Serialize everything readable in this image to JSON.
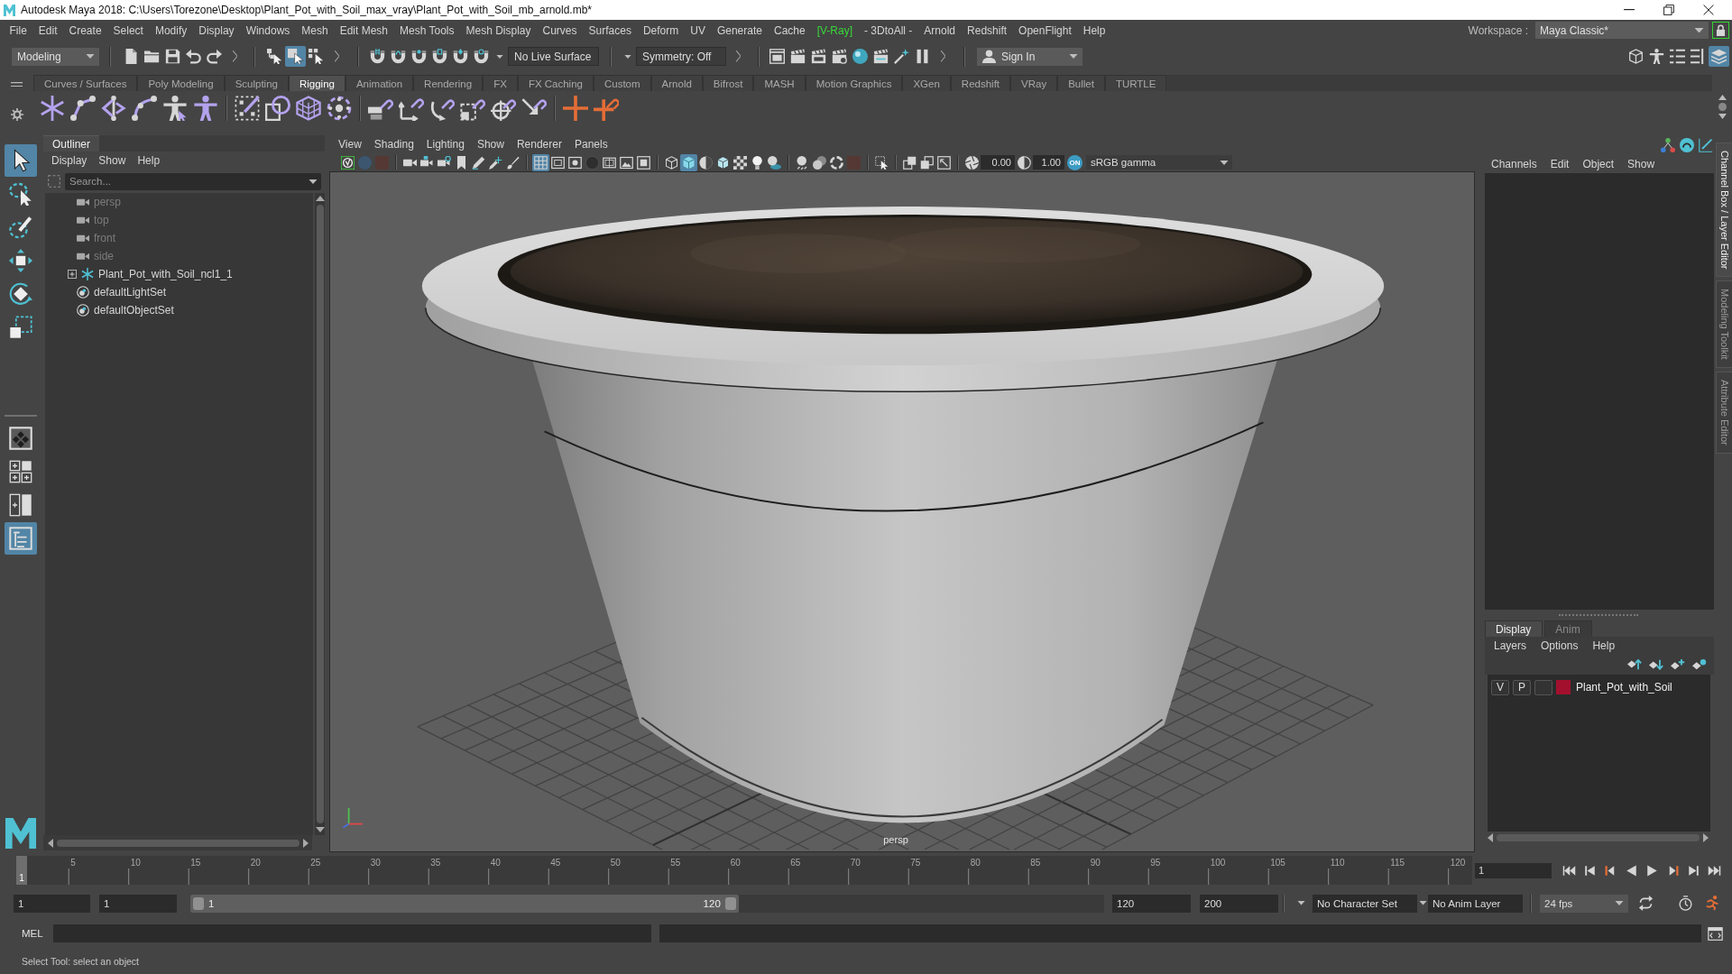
{
  "window": {
    "title": "Autodesk Maya 2018: C:\\Users\\Torezone\\Desktop\\Plant_Pot_with_Soil_max_vray\\Plant_Pot_with_Soil_mb_arnold.mb*"
  },
  "menu_bar": {
    "items": [
      {
        "label": "File",
        "highlighted": false
      },
      {
        "label": "Edit",
        "highlighted": false
      },
      {
        "label": "Create",
        "highlighted": false
      },
      {
        "label": "Select",
        "highlighted": false
      },
      {
        "label": "Modify",
        "highlighted": false
      },
      {
        "label": "Display",
        "highlighted": false
      },
      {
        "label": "Windows",
        "highlighted": false
      },
      {
        "label": "Mesh",
        "highlighted": false
      },
      {
        "label": "Edit Mesh",
        "highlighted": false
      },
      {
        "label": "Mesh Tools",
        "highlighted": false
      },
      {
        "label": "Mesh Display",
        "highlighted": false
      },
      {
        "label": "Curves",
        "highlighted": false
      },
      {
        "label": "Surfaces",
        "highlighted": false
      },
      {
        "label": "Deform",
        "highlighted": false
      },
      {
        "label": "UV",
        "highlighted": false
      },
      {
        "label": "Generate",
        "highlighted": false
      },
      {
        "label": "Cache",
        "highlighted": false
      },
      {
        "label": "[V-Ray]",
        "highlighted": true
      },
      {
        "label": "- 3DtoAll -",
        "highlighted": false
      },
      {
        "label": "Arnold",
        "highlighted": false
      },
      {
        "label": "Redshift",
        "highlighted": false
      },
      {
        "label": "OpenFlight",
        "highlighted": false
      },
      {
        "label": "Help",
        "highlighted": false
      }
    ],
    "workspace_label": "Workspace :",
    "workspace": "Maya Classic*"
  },
  "status_line": {
    "menu_set": "Modeling",
    "select_modes": [
      {
        "selected": false
      },
      {
        "selected": true
      },
      {
        "selected": false
      }
    ],
    "live_surface": "No Live Surface",
    "symmetry": "Symmetry: Off",
    "sign_in": "Sign In",
    "panel_toggles": [
      {
        "on": false
      },
      {
        "on": false
      },
      {
        "on": false
      },
      {
        "on": false
      },
      {
        "on": true
      }
    ]
  },
  "shelf": {
    "tabs": [
      {
        "label": "Curves / Surfaces",
        "selected": false
      },
      {
        "label": "Poly Modeling",
        "selected": false
      },
      {
        "label": "Sculpting",
        "selected": false
      },
      {
        "label": "Rigging",
        "selected": true
      },
      {
        "label": "Animation",
        "selected": false
      },
      {
        "label": "Rendering",
        "selected": false
      },
      {
        "label": "FX",
        "selected": false
      },
      {
        "label": "FX Caching",
        "selected": false
      },
      {
        "label": "Custom",
        "selected": false
      },
      {
        "label": "Arnold",
        "selected": false
      },
      {
        "label": "Bifrost",
        "selected": false
      },
      {
        "label": "MASH",
        "selected": false
      },
      {
        "label": "Motion Graphics",
        "selected": false
      },
      {
        "label": "XGen",
        "selected": false
      },
      {
        "label": "Redshift",
        "selected": false
      },
      {
        "label": "VRay",
        "selected": false
      },
      {
        "label": "Bullet",
        "selected": false
      },
      {
        "label": "TURTLE",
        "selected": false
      }
    ]
  },
  "toolbox": {
    "tools": [
      {
        "selected": true
      },
      {
        "selected": false
      },
      {
        "selected": false
      },
      {
        "selected": false
      },
      {
        "selected": false
      },
      {
        "selected": false
      }
    ],
    "layouts": [
      {
        "selected": false
      },
      {
        "selected": false
      },
      {
        "selected": false
      },
      {
        "selected": true
      }
    ]
  },
  "outliner": {
    "title": "Outliner",
    "menu": [
      "Display",
      "Show",
      "Help"
    ],
    "search": {
      "placeholder": "Search..."
    },
    "items": [
      {
        "label": "persp",
        "kind": "camera",
        "dimmed": true
      },
      {
        "label": "top",
        "kind": "camera",
        "dimmed": true
      },
      {
        "label": "front",
        "kind": "camera",
        "dimmed": true
      },
      {
        "label": "side",
        "kind": "camera",
        "dimmed": true
      },
      {
        "label": "Plant_Pot_with_Soil_ncl1_1",
        "kind": "transform",
        "dimmed": false,
        "expanded": false
      },
      {
        "label": "defaultLightSet",
        "kind": "set",
        "dimmed": false
      },
      {
        "label": "defaultObjectSet",
        "kind": "set",
        "dimmed": false
      }
    ]
  },
  "viewport": {
    "menu": [
      "View",
      "Shading",
      "Lighting",
      "Show",
      "Renderer",
      "Panels"
    ],
    "toolbar": [
      {
        "on": false
      },
      {
        "on": false
      },
      {
        "on": false
      },
      {
        "on": false
      },
      {
        "on": false
      },
      {
        "on": false
      },
      {
        "on": false
      },
      {
        "on": false
      },
      {
        "on": false
      },
      {
        "on": false
      },
      {
        "on": true
      },
      {
        "on": false
      },
      {
        "on": false
      },
      {
        "on": false
      },
      {
        "on": false
      },
      {
        "on": false
      },
      {
        "on": false
      },
      {
        "on": false
      },
      {
        "on": true
      },
      {
        "on": false
      },
      {
        "on": false
      },
      {
        "on": false
      },
      {
        "on": false
      },
      {
        "on": false
      },
      {
        "on": false
      },
      {
        "on": false
      },
      {
        "on": false
      },
      {
        "on": false
      },
      {
        "on": false
      },
      {
        "on": false
      },
      {
        "on": false
      },
      {
        "on": false
      }
    ],
    "exposure": "0.00",
    "gamma": "1.00",
    "color_management": {
      "label": "ON",
      "on": true
    },
    "color_space": "sRGB gamma",
    "camera": "persp"
  },
  "channel_box": {
    "menu": [
      "Channels",
      "Edit",
      "Object",
      "Show"
    ],
    "layer_tabs": [
      {
        "label": "Display",
        "selected": true
      },
      {
        "label": "Anim",
        "selected": false
      }
    ],
    "layer_menu": [
      "Layers",
      "Options",
      "Help"
    ],
    "layers": [
      {
        "visibility": "V",
        "playback": "P",
        "color": "#a3102d",
        "name": "Plant_Pot_with_Soil"
      }
    ]
  },
  "side_tabs": [
    {
      "label": "Channel Box / Layer Editor",
      "selected": true
    },
    {
      "label": "Modeling Toolkit",
      "selected": false
    },
    {
      "label": "Attribute Editor",
      "selected": false
    }
  ],
  "timeline": {
    "level": 0,
    "current_frame_marker": "1",
    "frame_labels": [
      "5",
      "10",
      "15",
      "20",
      "25",
      "30",
      "35",
      "40",
      "45",
      "50",
      "55",
      "60",
      "65",
      "70",
      "75",
      "80",
      "85",
      "90",
      "95",
      "100",
      "105",
      "110",
      "115",
      "120"
    ],
    "current_frame": "1"
  },
  "range": {
    "start": "1",
    "playback_start": "1",
    "slider_start": "1",
    "slider_end": "120",
    "level": 0.6,
    "playback_end": "120",
    "end": "200",
    "character_set": "No Character Set",
    "anim_layer": "No Anim Layer",
    "fps": "24 fps"
  },
  "command_line": {
    "language": "MEL"
  },
  "help_line": {
    "text": "Select Tool: select an object"
  }
}
